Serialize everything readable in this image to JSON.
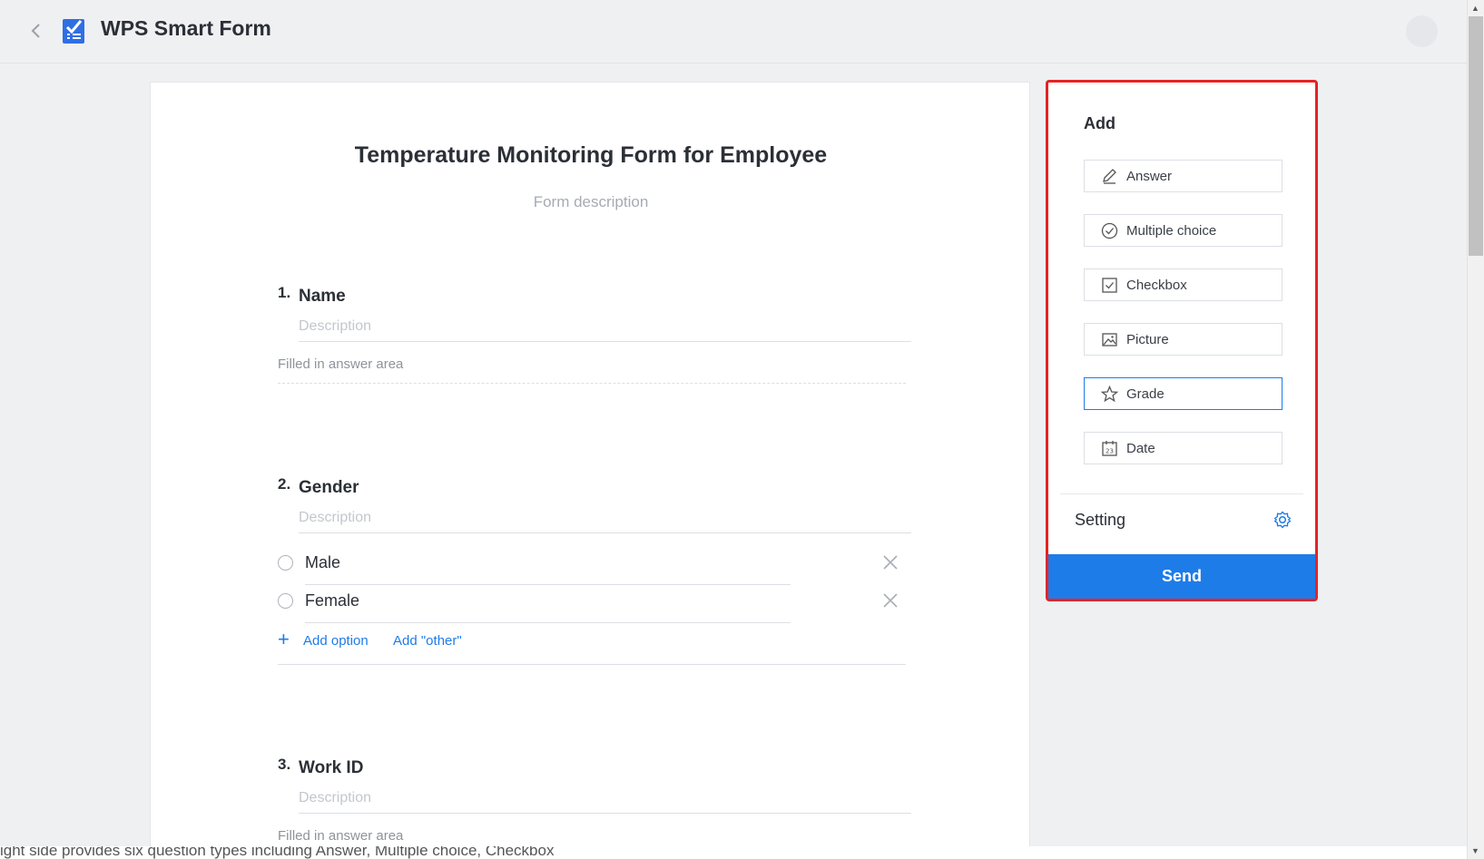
{
  "header": {
    "app_title": "WPS Smart Form"
  },
  "form": {
    "title": "Temperature Monitoring Form for Employee",
    "description": "Form description",
    "questions": [
      {
        "number": "1.",
        "title": "Name",
        "description_placeholder": "Description",
        "answer_hint": "Filled in answer area"
      },
      {
        "number": "2.",
        "title": "Gender",
        "description_placeholder": "Description",
        "options": [
          "Male",
          "Female"
        ],
        "add_option_label": "Add option",
        "add_other_label": "Add \"other\""
      },
      {
        "number": "3.",
        "title": "Work ID",
        "description_placeholder": "Description",
        "answer_hint": "Filled in answer area"
      }
    ]
  },
  "panel": {
    "add_heading": "Add",
    "question_types": [
      {
        "label": "Answer",
        "icon": "pencil-icon"
      },
      {
        "label": "Multiple choice",
        "icon": "check-circle-icon"
      },
      {
        "label": "Checkbox",
        "icon": "checkbox-icon"
      },
      {
        "label": "Picture",
        "icon": "image-icon"
      },
      {
        "label": "Grade",
        "icon": "star-icon"
      },
      {
        "label": "Date",
        "icon": "calendar-icon"
      }
    ],
    "active_type": "Grade",
    "setting_label": "Setting",
    "send_label": "Send"
  },
  "caption": "ight side provides six question types including Answer, Multiple choice, Checkbox",
  "colors": {
    "accent": "#1e7ce8",
    "highlight_border": "#e52323",
    "background": "#eff0f2"
  }
}
